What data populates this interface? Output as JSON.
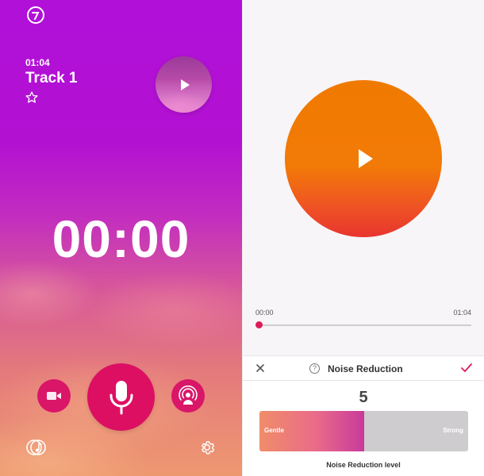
{
  "recorder": {
    "track_time": "01:04",
    "track_name": "Track 1",
    "timer": "00:00",
    "icons": {
      "logo": "app-logo-icon",
      "star": "star-icon",
      "play": "play-icon",
      "video": "video-camera-icon",
      "mic": "microphone-icon",
      "podcast": "podcast-icon",
      "music": "music-library-icon",
      "settings": "gear-icon"
    },
    "colors": {
      "accent": "#dc0f63",
      "bg_top": "#b010d8",
      "bg_bottom": "#ee9870"
    }
  },
  "player": {
    "position_start": "00:00",
    "position_end": "01:04",
    "progress": 0.0,
    "colors": {
      "disc_top": "#f07a00",
      "disc_bottom": "#e8352f",
      "progress_dot": "#dc1c5a"
    }
  },
  "noise_sheet": {
    "title": "Noise Reduction",
    "level": "5",
    "level_fraction": 0.5,
    "gentle_label": "Gentle",
    "strong_label": "Strong",
    "caption": "Noise Reduction level",
    "icons": {
      "close": "close-icon",
      "help": "help-icon",
      "confirm": "checkmark-icon"
    },
    "colors": {
      "confirm": "#dc1c5a"
    }
  }
}
